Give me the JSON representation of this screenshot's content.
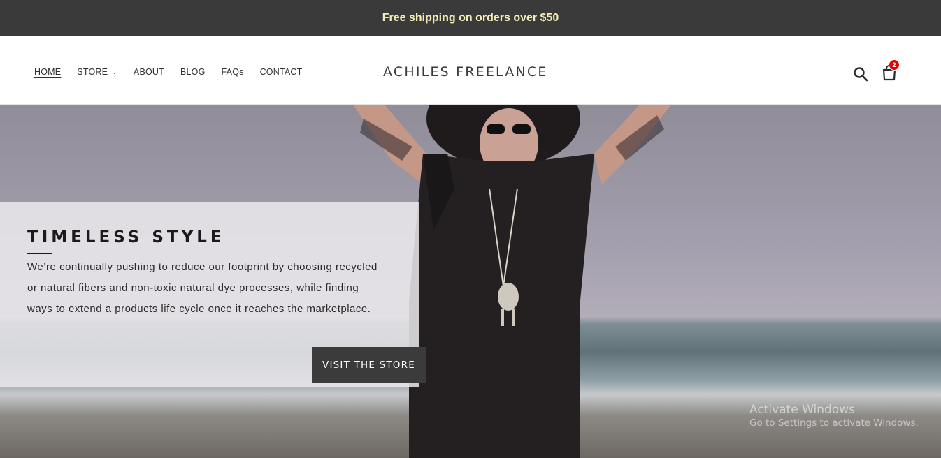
{
  "announcement": {
    "text": "Free shipping on orders over $50"
  },
  "nav": {
    "items": [
      {
        "label": "HOME",
        "active": true
      },
      {
        "label": "STORE",
        "has_dropdown": true
      },
      {
        "label": "ABOUT"
      },
      {
        "label": "BLOG"
      },
      {
        "label": "FAQs"
      },
      {
        "label": "CONTACT"
      }
    ]
  },
  "brand": {
    "name": "ACHILES FREELANCE"
  },
  "header_icons": {
    "search": "search-icon",
    "cart": "cart-icon",
    "cart_count": "2"
  },
  "hero": {
    "title": "TIMELESS STYLE",
    "text": "We’re continually pushing to reduce our footprint by choosing recycled or natural fibers and non-toxic natural dye processes, while finding ways to extend a products life cycle once it reaches the marketplace.",
    "cta_label": "VISIT THE STORE"
  },
  "watermark": {
    "title": "Activate Windows",
    "subtitle": "Go to Settings to activate Windows."
  },
  "colors": {
    "announcement_bg": "#3a3a3a",
    "announcement_text": "#f4ecb5",
    "cta_bg": "#3b3b3b",
    "badge": "#e60000"
  }
}
